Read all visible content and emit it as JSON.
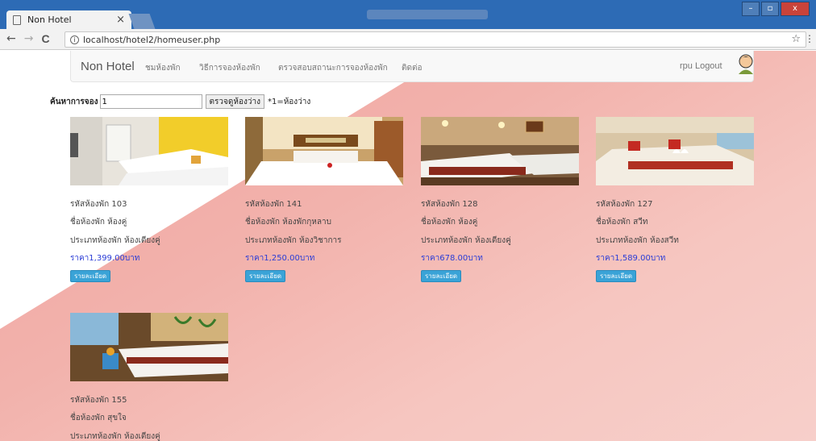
{
  "browser": {
    "tab_title": "Non Hotel",
    "tab_close": "×",
    "url": "localhost/hotel2/homeuser.php",
    "back": "←",
    "forward": "→",
    "reload": "C",
    "star": "☆",
    "menu": "⋮",
    "info": "i"
  },
  "navbar": {
    "brand": "Non Hotel",
    "links": [
      "ชมห้องพัก",
      "วิธีการจองห้องพัก",
      "ตรวจสอบสถานะการจองห้องพัก",
      "ติดต่อ"
    ],
    "user": "rpu Logout"
  },
  "search": {
    "label": "ค้นหาการจอง",
    "value": "1",
    "button": "ตรวจดูห้องว่าง",
    "hint": "*1=ห้องว่าง"
  },
  "rooms": [
    {
      "code": "รหัสห้องพัก 103",
      "name": "ชื่อห้องพัก ห้องคู่",
      "type": "ประเภทห้องพัก ห้องเตียงคู่",
      "price": "ราคา1,399.00บาท",
      "button": "รายละเอียด"
    },
    {
      "code": "รหัสห้องพัก 141",
      "name": "ชื่อห้องพัก ห้องพักกุหลาบ",
      "type": "ประเภทห้องพัก ห้องวิชาการ",
      "price": "ราคา1,250.00บาท",
      "button": "รายละเอียด"
    },
    {
      "code": "รหัสห้องพัก 128",
      "name": "ชื่อห้องพัก ห้องคู่",
      "type": "ประเภทห้องพัก ห้องเตียงคู่",
      "price": "ราคา678.00บาท",
      "button": "รายละเอียด"
    },
    {
      "code": "รหัสห้องพัก 127",
      "name": "ชื่อห้องพัก สวีท",
      "type": "ประเภทห้องพัก ห้องสวีท",
      "price": "ราคา1,589.00บาท",
      "button": "รายละเอียด"
    },
    {
      "code": "รหัสห้องพัก 155",
      "name": "ชื่อห้องพัก สุขใจ",
      "type": "ประเภทห้องพัก ห้องเตียงคู่",
      "price": "",
      "button": ""
    }
  ]
}
